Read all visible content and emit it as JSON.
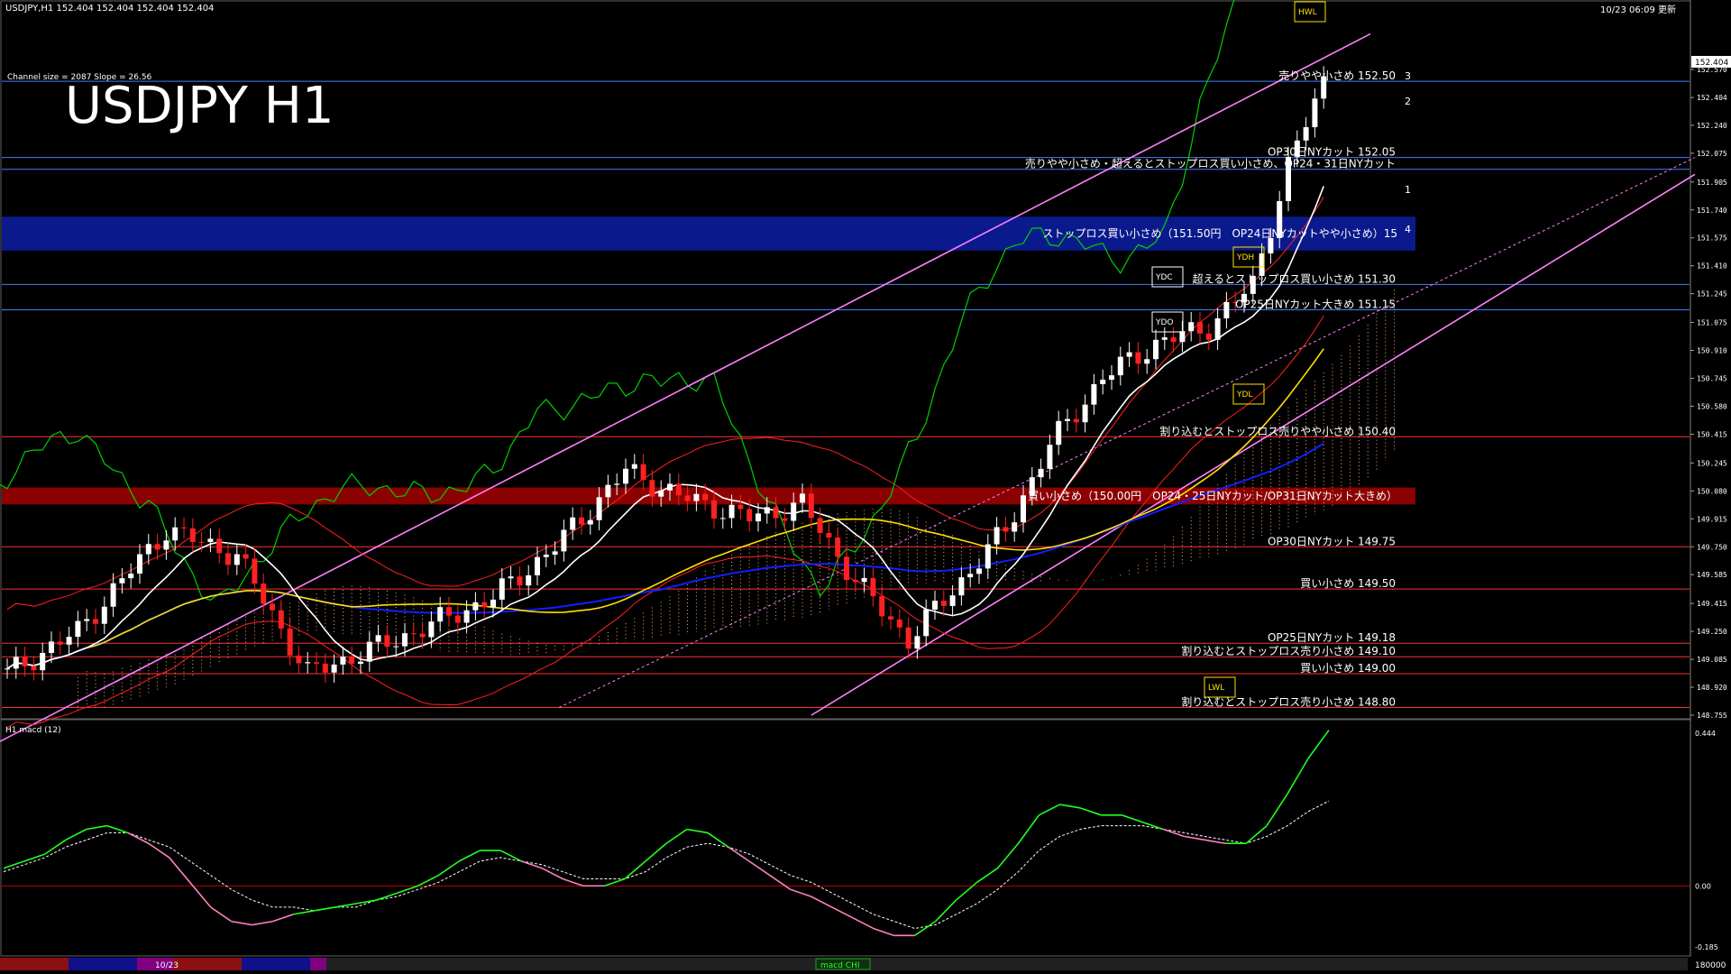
{
  "header": {
    "symbol_info": "USDJPY,H1  152.404 152.404 152.404 152.404",
    "timestamp": "10/23 06:09 更新",
    "channel_info": "Channel size = 2087 Slope = 26.56",
    "big_title": "USDJPY H1",
    "macd_title": "H1  macd (12)",
    "current_price": "152.404"
  },
  "colors": {
    "background": "#000000",
    "bull": "#ffffff",
    "bear": "#ff2020",
    "channel": "#ff80ff",
    "ma_fast": "#ffffff",
    "ma_mid": "#ffe000",
    "ma_slow": "#1020ff",
    "chikou": "#00d000",
    "bollinger": "#ff2020",
    "zone_blue": "#0a1a8c",
    "zone_red": "#8b0000",
    "macd_up": "#20ff20",
    "macd_down": "#ff80c0"
  },
  "chart_data": {
    "type": "candlestick",
    "title": "USDJPY H1",
    "ylim": [
      148.755,
      152.735
    ],
    "y_ticks": [
      "152.570",
      "152.404",
      "152.240",
      "152.075",
      "151.905",
      "151.740",
      "151.575",
      "151.410",
      "151.245",
      "151.075",
      "150.910",
      "150.745",
      "150.580",
      "150.415",
      "150.245",
      "150.080",
      "149.915",
      "149.750",
      "149.585",
      "149.415",
      "149.250",
      "149.085",
      "148.920",
      "148.755"
    ],
    "ohlc": [],
    "levels": [
      {
        "price": 152.5,
        "label": "売りやや小さめ 152.50",
        "color": "#4080ff"
      },
      {
        "price": 152.05,
        "label": "OP30日NYカット 152.05",
        "color": "#4080ff"
      },
      {
        "price": 151.98,
        "label": "売りやや小さめ・超えるとストップロス買い小さめ、OP24・31日NYカット",
        "color": "#4080ff"
      },
      {
        "price": 151.3,
        "label": "超えるとストップロス買い小さめ 151.30",
        "color": "#4080ff"
      },
      {
        "price": 151.15,
        "label": "OP25日NYカット大きめ 151.15",
        "color": "#4080ff"
      },
      {
        "price": 150.4,
        "label": "割り込むとストップロス売りやや小さめ 150.40",
        "color": "#ff3030"
      },
      {
        "price": 149.75,
        "label": "OP30日NYカット 149.75",
        "color": "#ff3030"
      },
      {
        "price": 149.5,
        "label": "買い小さめ 149.50",
        "color": "#ff3030"
      },
      {
        "price": 149.18,
        "label": "OP25日NYカット 149.18",
        "color": "#ff3030"
      },
      {
        "price": 149.1,
        "label": "割り込むとストップロス売り小さめ 149.10",
        "color": "#ff3030"
      },
      {
        "price": 149.0,
        "label": "買い小さめ 149.00",
        "color": "#ff3030"
      },
      {
        "price": 148.8,
        "label": "割り込むとストップロス売り小さめ 148.80",
        "color": "#ff3030"
      }
    ],
    "zones": [
      {
        "from": 151.5,
        "to": 151.7,
        "color": "#0a1a8c",
        "label": "ストップロス買い小さめ（151.50円　OP24日NYカットやや小さめ）15"
      },
      {
        "from": 150.0,
        "to": 150.1,
        "color": "#8b0000",
        "label": "買い小さめ（150.00円　OP24・25日NYカット/OP31日NYカット大きめ）"
      }
    ],
    "box_labels": [
      "YDC",
      "YDO",
      "YDH",
      "YDL",
      "LWL",
      "HWL"
    ],
    "channel_labels": [
      "1",
      "2",
      "3",
      "4"
    ],
    "macd": {
      "zero_label": "0.00",
      "top_label": "0.444",
      "bottom_label": "-0.185",
      "ylim": [
        -0.185,
        0.444
      ],
      "main": [
        0.05,
        0.07,
        0.09,
        0.13,
        0.16,
        0.17,
        0.15,
        0.12,
        0.08,
        0.01,
        -0.06,
        -0.1,
        -0.11,
        -0.1,
        -0.08,
        -0.07,
        -0.06,
        -0.05,
        -0.04,
        -0.02,
        0.0,
        0.03,
        0.07,
        0.1,
        0.1,
        0.07,
        0.05,
        0.02,
        0.0,
        0.0,
        0.02,
        0.07,
        0.12,
        0.16,
        0.15,
        0.11,
        0.07,
        0.03,
        -0.01,
        -0.03,
        -0.06,
        -0.09,
        -0.12,
        -0.14,
        -0.14,
        -0.1,
        -0.04,
        0.01,
        0.05,
        0.12,
        0.2,
        0.23,
        0.22,
        0.2,
        0.2,
        0.18,
        0.16,
        0.14,
        0.13,
        0.12,
        0.12,
        0.17,
        0.26,
        0.36,
        0.44
      ],
      "signal": [
        0.04,
        0.06,
        0.08,
        0.11,
        0.13,
        0.15,
        0.15,
        0.13,
        0.11,
        0.07,
        0.03,
        -0.01,
        -0.04,
        -0.06,
        -0.06,
        -0.07,
        -0.06,
        -0.06,
        -0.04,
        -0.03,
        -0.01,
        0.01,
        0.04,
        0.07,
        0.08,
        0.07,
        0.06,
        0.04,
        0.02,
        0.02,
        0.02,
        0.04,
        0.08,
        0.11,
        0.12,
        0.11,
        0.09,
        0.06,
        0.03,
        0.01,
        -0.02,
        -0.05,
        -0.08,
        -0.1,
        -0.12,
        -0.11,
        -0.08,
        -0.05,
        -0.01,
        0.04,
        0.1,
        0.14,
        0.16,
        0.17,
        0.17,
        0.17,
        0.16,
        0.15,
        0.14,
        0.13,
        0.12,
        0.14,
        0.17,
        0.21,
        0.24
      ]
    }
  },
  "footer": {
    "date_label": "10/23",
    "macd_legend": "macd CHI",
    "right_value": "180000"
  }
}
